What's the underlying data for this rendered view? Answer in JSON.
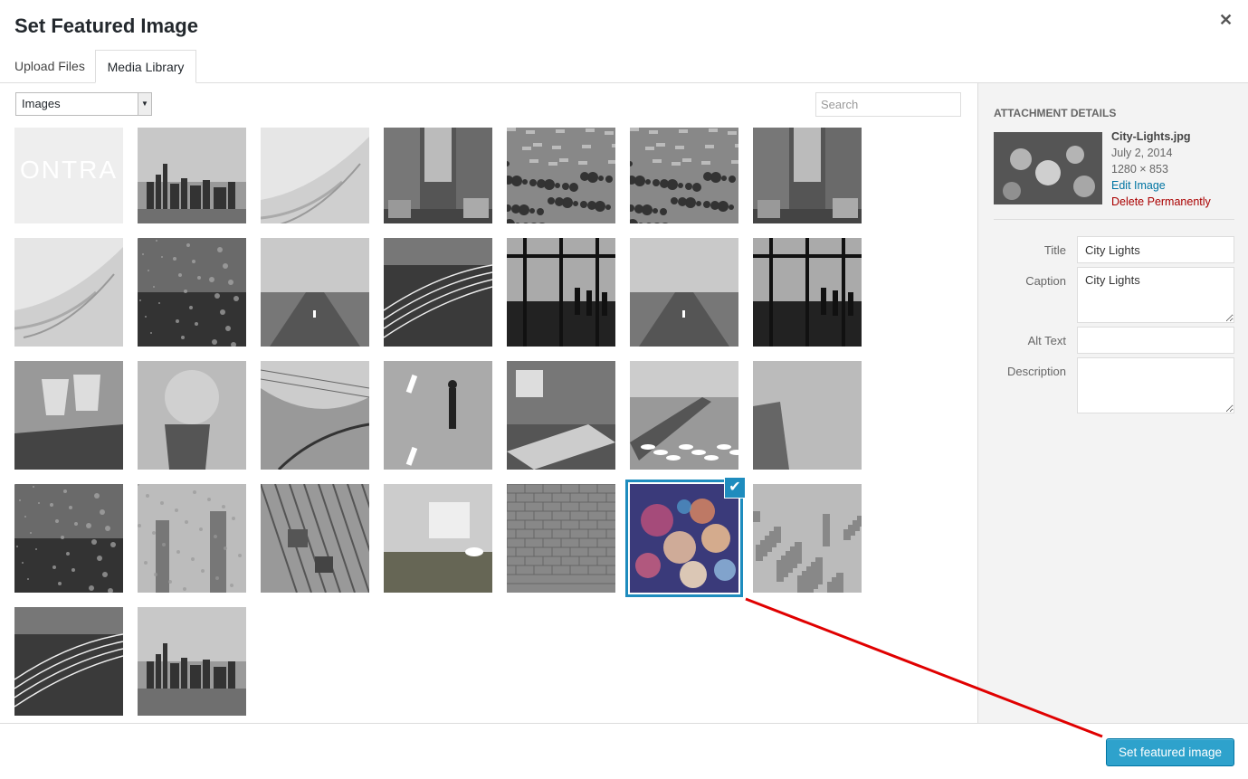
{
  "modal": {
    "title": "Set Featured Image",
    "close_icon": "close-icon"
  },
  "tabs": [
    {
      "label": "Upload Files"
    },
    {
      "label": "Media Library",
      "active": true
    }
  ],
  "toolbar": {
    "filter_value": "Images",
    "search_placeholder": "Search"
  },
  "attachments": [
    {
      "kind": "text-logo"
    },
    {
      "kind": "skyline"
    },
    {
      "kind": "architecture"
    },
    {
      "kind": "street"
    },
    {
      "kind": "crowd"
    },
    {
      "kind": "crowd"
    },
    {
      "kind": "street"
    },
    {
      "kind": "architecture"
    },
    {
      "kind": "rain-window"
    },
    {
      "kind": "road"
    },
    {
      "kind": "light-trails"
    },
    {
      "kind": "window-view"
    },
    {
      "kind": "road"
    },
    {
      "kind": "window-view"
    },
    {
      "kind": "ship"
    },
    {
      "kind": "cup"
    },
    {
      "kind": "station"
    },
    {
      "kind": "walker"
    },
    {
      "kind": "desk"
    },
    {
      "kind": "airplane-wing"
    },
    {
      "kind": "cliff"
    },
    {
      "kind": "rain-window"
    },
    {
      "kind": "rain-city"
    },
    {
      "kind": "locks"
    },
    {
      "kind": "laptop"
    },
    {
      "kind": "brick-wall"
    },
    {
      "kind": "bokeh",
      "selected": true
    },
    {
      "kind": "city-aerial"
    },
    {
      "kind": "light-trails"
    },
    {
      "kind": "skyline"
    }
  ],
  "attachment_logo_text": "ONTRA",
  "details": {
    "heading": "Attachment Details",
    "filename": "City-Lights.jpg",
    "date": "July 2, 2014",
    "dimensions": "1280 × 853",
    "edit_link": "Edit Image",
    "delete_link": "Delete Permanently",
    "fields": {
      "title_label": "Title",
      "title_value": "City Lights",
      "caption_label": "Caption",
      "caption_value": "City Lights",
      "alt_label": "Alt Text",
      "alt_value": "",
      "description_label": "Description",
      "description_value": ""
    }
  },
  "footer": {
    "set_button": "Set featured image"
  },
  "colors": {
    "accent": "#1e8cbe",
    "button": "#2ea2cc",
    "annotation_arrow": "#e00000"
  }
}
